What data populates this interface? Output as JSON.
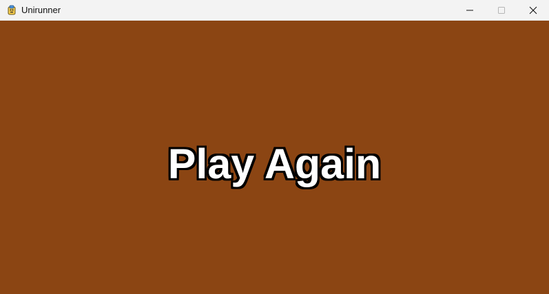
{
  "window": {
    "title": "Unirunner",
    "app_icon": "pygame-snake-icon",
    "controls": {
      "minimize_icon": "minimize-icon",
      "maximize_icon": "maximize-icon",
      "close_icon": "close-icon"
    }
  },
  "game": {
    "background_color": "#8b4513",
    "play_again_label": "Play Again",
    "text_color": "#ffffff",
    "outline_color": "#000000"
  }
}
